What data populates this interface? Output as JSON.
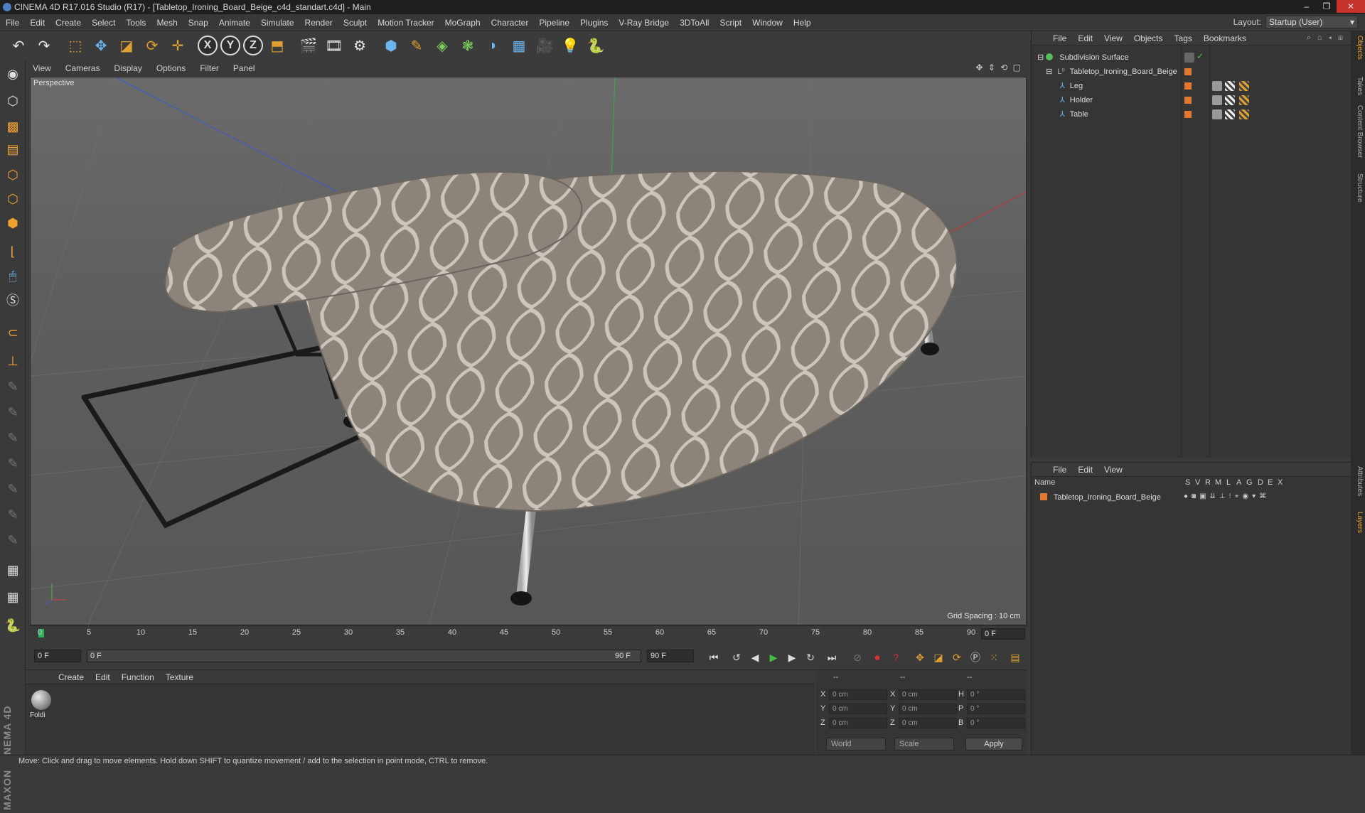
{
  "window": {
    "title": "CINEMA 4D R17.016 Studio (R17) - [Tabletop_Ironing_Board_Beige_c4d_standart.c4d] - Main",
    "controls": [
      "–",
      "❐",
      "✕"
    ]
  },
  "menubar": {
    "items": [
      "File",
      "Edit",
      "Create",
      "Select",
      "Tools",
      "Mesh",
      "Snap",
      "Animate",
      "Simulate",
      "Render",
      "Sculpt",
      "Motion Tracker",
      "MoGraph",
      "Character",
      "Pipeline",
      "Plugins",
      "V-Ray Bridge",
      "3DToAll",
      "Script",
      "Window",
      "Help"
    ],
    "layout_label": "Layout:",
    "layout_value": "Startup (User)"
  },
  "toolbar": {
    "axis_x": "X",
    "axis_y": "Y",
    "axis_z": "Z"
  },
  "viewport": {
    "menu": [
      "View",
      "Cameras",
      "Display",
      "Options",
      "Filter",
      "Panel"
    ],
    "icons": "✥ ⇕ ⟲ ▢",
    "label": "Perspective",
    "grid_spacing": "Grid Spacing : 10 cm"
  },
  "timeline": {
    "ticks": [
      "0",
      "5",
      "10",
      "15",
      "20",
      "25",
      "30",
      "35",
      "40",
      "45",
      "50",
      "55",
      "60",
      "65",
      "70",
      "75",
      "80",
      "85",
      "90"
    ],
    "current_frame": "0 F"
  },
  "transport": {
    "start_field": "0 F",
    "range_start": "0 F",
    "range_end": "90 F",
    "end_field": "90 F"
  },
  "objects_panel": {
    "menu": [
      "File",
      "Edit",
      "View",
      "Objects",
      "Tags",
      "Bookmarks"
    ],
    "rows": [
      {
        "name": "Subdivision Surface"
      },
      {
        "name": "Tabletop_Ironing_Board_Beige"
      },
      {
        "name": "Leg"
      },
      {
        "name": "Holder"
      },
      {
        "name": "Table"
      }
    ]
  },
  "layers_panel": {
    "menu": [
      "File",
      "Edit",
      "View"
    ],
    "header_name": "Name",
    "header_cols": [
      "S",
      "V",
      "R",
      "M",
      "L",
      "A",
      "G",
      "D",
      "E",
      "X"
    ],
    "row_name": "Tabletop_Ironing_Board_Beige"
  },
  "right_tabs": [
    "Objects",
    "Takes",
    "Content Browser",
    "Structure",
    "Attributes",
    "Layers"
  ],
  "material_panel": {
    "menu": [
      "Create",
      "Edit",
      "Function",
      "Texture"
    ],
    "material_name": "Foldi"
  },
  "coords_panel": {
    "headers": [
      "--",
      "--",
      "--"
    ],
    "rows": [
      {
        "l1": "X",
        "v1": "0 cm",
        "l2": "X",
        "v2": "0 cm",
        "l3": "H",
        "v3": "0 °"
      },
      {
        "l1": "Y",
        "v1": "0 cm",
        "l2": "Y",
        "v2": "0 cm",
        "l3": "P",
        "v3": "0 °"
      },
      {
        "l1": "Z",
        "v1": "0 cm",
        "l2": "Z",
        "v2": "0 cm",
        "l3": "B",
        "v3": "0 °"
      }
    ],
    "mode": "World",
    "type": "Scale",
    "apply_label": "Apply"
  },
  "maxon_logo": "MAXON CINEMA 4D",
  "statusbar": {
    "text": "Move: Click and drag to move elements. Hold down SHIFT to quantize movement / add to the selection in point mode, CTRL to remove."
  },
  "colors": {
    "accent": "#e0a030",
    "layer_orange": "#e07830",
    "playhead": "#2fb35a"
  }
}
